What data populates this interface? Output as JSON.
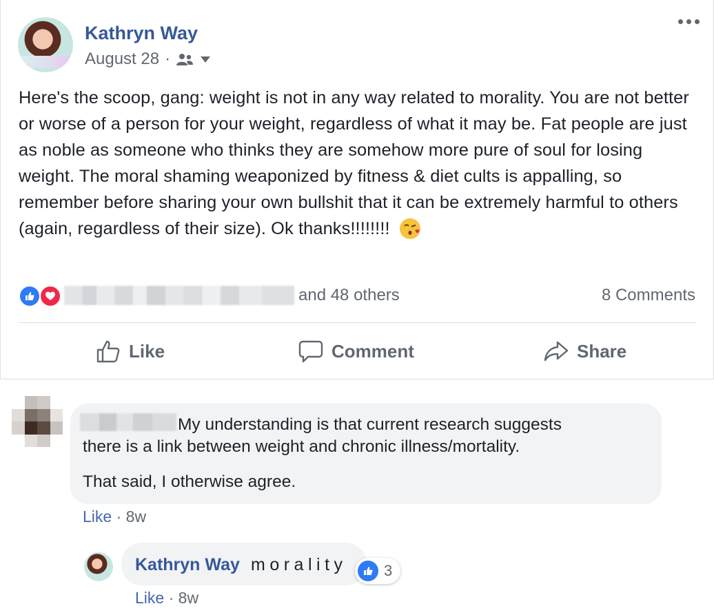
{
  "post": {
    "author": "Kathryn Way",
    "date": "August 28",
    "meta_separator": "·",
    "audience_icon": "friends-icon",
    "text": "Here's the scoop, gang: weight is not in any way related to morality. You are not better or worse of a person for your weight, regardless of what it may be. Fat people are just as noble as someone who thinks they are somehow more pure of soul for losing weight. The moral shaming weaponized by fitness & diet cults is appalling, so remember before sharing your own bullshit that it can be extremely harmful to others (again, regardless of their size). Ok thanks!!!!!!!!",
    "emoji": "kissing-face-emoji",
    "reactions": {
      "types": [
        "like",
        "love"
      ],
      "others_text": "and 48 others",
      "comments_count": "8 Comments"
    },
    "actions": {
      "like_label": "Like",
      "comment_label": "Comment",
      "share_label": "Share"
    }
  },
  "comment": {
    "line1": "My understanding is that current research suggests",
    "line2": "there is a link between weight and chronic illness/mortality.",
    "line3": "That said, I otherwise agree.",
    "like_label": "Like",
    "separator": "·",
    "time": "8w"
  },
  "reply": {
    "author": "Kathryn Way",
    "text": "morality",
    "reaction_count": "3",
    "like_label": "Like",
    "separator": "·",
    "time": "8w"
  },
  "colors": {
    "link_blue": "#365899",
    "like_blue": "#2f7bf5",
    "love_red": "#f0284a",
    "muted_text": "#616770",
    "bubble_bg": "#f2f3f5"
  }
}
